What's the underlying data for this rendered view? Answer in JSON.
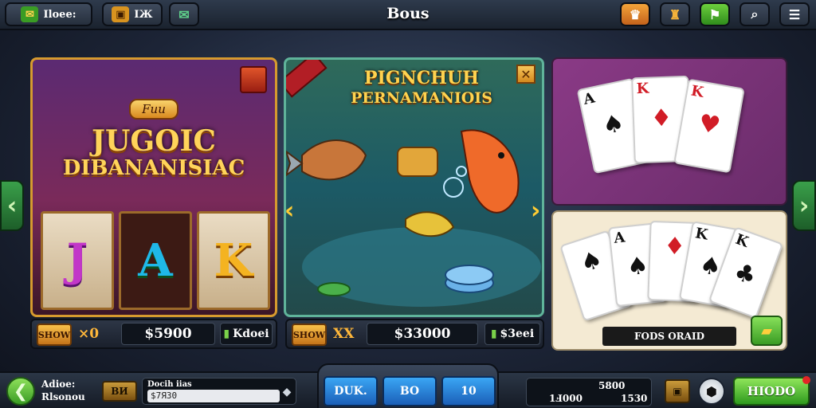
{
  "header": {
    "title": "Bous",
    "left_button_1": "Iloee:",
    "left_button_2": "IЖ",
    "right_icons": [
      "crown-chest-icon",
      "trophy-icon",
      "flag-icon",
      "search-icon",
      "menu-icon"
    ]
  },
  "slots_panel": {
    "tag": "Fuu",
    "title_line1": "JUGOIC",
    "title_line2": "DIBANANISIAC",
    "reels": [
      "J",
      "A",
      "K"
    ],
    "info": {
      "tag": "SHOW",
      "multiplier": "×0",
      "amount": "$5900",
      "right_label": "Kdoei"
    }
  },
  "fish_panel": {
    "title_line1": "PIGNCHUH",
    "title_line2": "PERNAMANIOIS",
    "close_label": "✕",
    "info": {
      "tag": "SHOW",
      "multiplier": "XX",
      "amount": "$33000",
      "right_label": "$3eei"
    }
  },
  "cards_panel": {
    "caption": "FODS ORAID"
  },
  "bottom_bar": {
    "player_name": "Adioe:",
    "player_sub": "Rlsonou",
    "chip_label": "ВИ",
    "field_label": "Docih iias",
    "field_value": "$7Я30",
    "tabs": [
      "DUK.",
      "BO",
      "10"
    ],
    "stats_line1": "5800",
    "stats_line2_left": "1Ⅎ000",
    "stats_line2_right": "1530",
    "hero_button": "HIODO"
  }
}
